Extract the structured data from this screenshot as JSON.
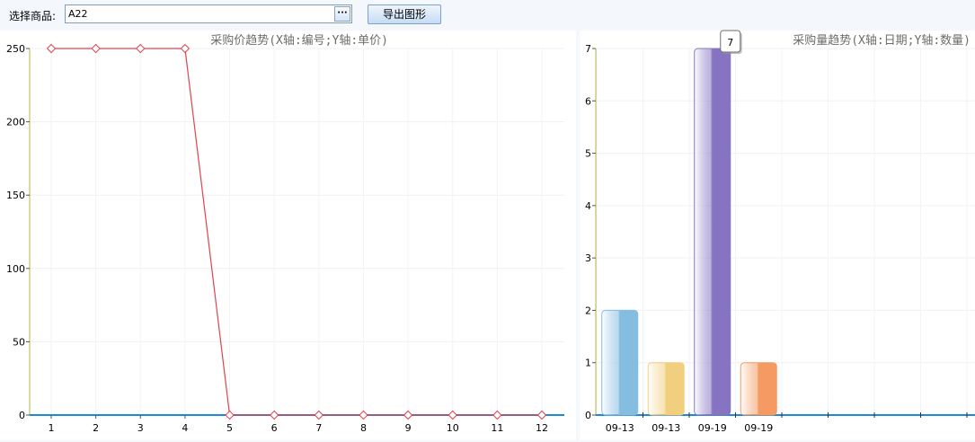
{
  "toolbar": {
    "product_label": "选择商品:",
    "product_value": "A22",
    "picker_button_label": "···",
    "export_label": "导出图形"
  },
  "chart_data": [
    {
      "type": "line",
      "title": "采购价趋势(X轴:编号;Y轴:单价)",
      "x": [
        1,
        2,
        3,
        4,
        5,
        6,
        7,
        8,
        9,
        10,
        11,
        12
      ],
      "series": [
        {
          "values": [
            250,
            250,
            250,
            250,
            0,
            0,
            0,
            0,
            0,
            0,
            0,
            0
          ]
        }
      ],
      "ylim": [
        0,
        250
      ],
      "yticks": [
        0,
        50,
        100,
        150,
        200,
        250
      ],
      "grid": true,
      "colors": {
        "line": "#e0434f",
        "marker_fill": "#ffffff",
        "axis": "#1b8ad8",
        "y_axis": "#b7b34a"
      }
    },
    {
      "type": "bar",
      "title": "采购量趋势(X轴:日期;Y轴:数量)",
      "categories": [
        "09-13",
        "09-13",
        "09-19",
        "09-19"
      ],
      "values": [
        2,
        1,
        7,
        1
      ],
      "ylim": [
        0,
        7
      ],
      "yticks": [
        0,
        1,
        2,
        3,
        4,
        5,
        6,
        7
      ],
      "grid": true,
      "tooltip": {
        "category_index": 2,
        "text": "7"
      },
      "colors": {
        "bars": [
          "#85bde0",
          "#f2cf7e",
          "#8674c2",
          "#f59a62"
        ],
        "axis": "#1b8ad8",
        "y_axis": "#b7b34a"
      }
    }
  ]
}
